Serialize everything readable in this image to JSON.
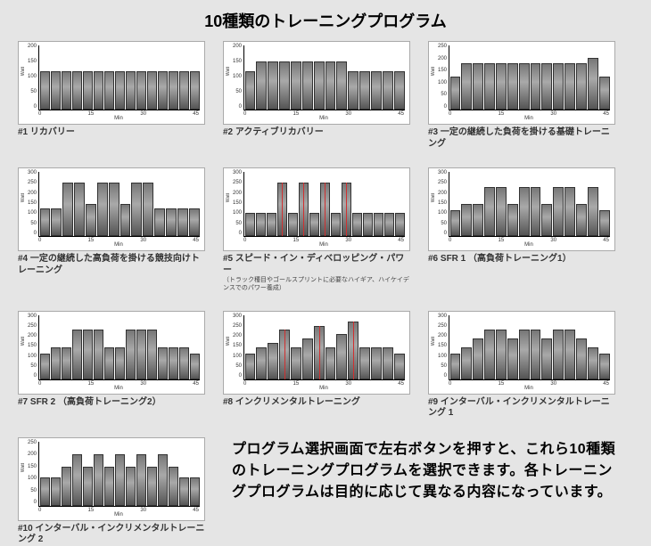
{
  "page_title": "10種類のトレーニングプログラム",
  "axis": {
    "xlabel": "Min",
    "ylabel": "Watt"
  },
  "xticks": [
    "0",
    "15",
    "30",
    "45"
  ],
  "description": "プログラム選択画面で左右ボタンを押すと、これら10種類のトレーニングプログラムを選択できます。各トレーニングプログラムは目的に応じて異なる内容になっています。",
  "chart_data": [
    {
      "id": 1,
      "label": "#1 リカバリー",
      "type": "bar",
      "ymax": 200,
      "yticks": [
        "200",
        "150",
        "100",
        "50",
        "0"
      ],
      "values": [
        120,
        120,
        120,
        120,
        120,
        120,
        120,
        120,
        120,
        120,
        120,
        120,
        120,
        120,
        120
      ],
      "markers": []
    },
    {
      "id": 2,
      "label": "#2 アクティブリカバリー",
      "type": "bar",
      "ymax": 200,
      "yticks": [
        "200",
        "150",
        "100",
        "50",
        "0"
      ],
      "values": [
        120,
        150,
        150,
        150,
        150,
        150,
        150,
        150,
        150,
        120,
        120,
        120,
        120,
        120
      ],
      "markers": []
    },
    {
      "id": 3,
      "label": "#3 一定の継続した負荷を掛ける基礎トレーニング",
      "type": "bar",
      "ymax": 250,
      "yticks": [
        "250",
        "200",
        "150",
        "100",
        "50",
        "0"
      ],
      "values": [
        130,
        180,
        180,
        180,
        180,
        180,
        180,
        180,
        180,
        180,
        180,
        180,
        200,
        130
      ],
      "markers": []
    },
    {
      "id": 4,
      "label": "#4 一定の継続した高負荷を掛ける競技向けトレーニング",
      "type": "bar",
      "ymax": 300,
      "yticks": [
        "300",
        "250",
        "200",
        "150",
        "100",
        "50",
        "0"
      ],
      "values": [
        130,
        130,
        250,
        250,
        150,
        250,
        250,
        150,
        250,
        250,
        130,
        130,
        130,
        130
      ],
      "markers": []
    },
    {
      "id": 5,
      "label": "#5 スピード・イン・ディベロッピング・パワー",
      "sublabel": "（トラック種目やゴールスプリントに必要なハイギア、ハイケイデンスでのパワー養成）",
      "type": "bar",
      "ymax": 300,
      "yticks": [
        "300",
        "250",
        "200",
        "150",
        "100",
        "50",
        "0"
      ],
      "values": [
        110,
        110,
        110,
        250,
        110,
        250,
        110,
        250,
        110,
        250,
        110,
        110,
        110,
        110,
        110
      ],
      "markers": [
        3,
        5,
        7,
        9
      ]
    },
    {
      "id": 6,
      "label": "#6 SFR 1 （高負荷トレーニング1）",
      "type": "bar",
      "ymax": 300,
      "yticks": [
        "300",
        "250",
        "200",
        "150",
        "100",
        "50",
        "0"
      ],
      "values": [
        120,
        150,
        150,
        230,
        230,
        150,
        230,
        230,
        150,
        230,
        230,
        150,
        230,
        120
      ],
      "markers": []
    },
    {
      "id": 7,
      "label": "#7 SFR 2 （高負荷トレーニング2）",
      "type": "bar",
      "ymax": 300,
      "yticks": [
        "300",
        "250",
        "200",
        "150",
        "100",
        "50",
        "0"
      ],
      "values": [
        120,
        150,
        150,
        230,
        230,
        230,
        150,
        150,
        230,
        230,
        230,
        150,
        150,
        150,
        120
      ],
      "markers": []
    },
    {
      "id": 8,
      "label": "#8 インクリメンタルトレーニング",
      "type": "bar",
      "ymax": 300,
      "yticks": [
        "300",
        "250",
        "200",
        "150",
        "100",
        "50",
        "0"
      ],
      "values": [
        120,
        150,
        170,
        230,
        150,
        190,
        250,
        150,
        210,
        270,
        150,
        150,
        150,
        120
      ],
      "markers": [
        3,
        6,
        9
      ]
    },
    {
      "id": 9,
      "label": "#9 インターバル・インクリメンタルトレーニング 1",
      "type": "bar",
      "ymax": 300,
      "yticks": [
        "300",
        "250",
        "200",
        "150",
        "100",
        "50",
        "0"
      ],
      "values": [
        120,
        150,
        190,
        230,
        230,
        190,
        230,
        230,
        190,
        230,
        230,
        190,
        150,
        120
      ],
      "markers": []
    },
    {
      "id": 10,
      "label": "#10 インターバル・インクリメンタルトレーニング 2",
      "type": "bar",
      "ymax": 250,
      "yticks": [
        "250",
        "200",
        "150",
        "100",
        "50",
        "0"
      ],
      "values": [
        110,
        110,
        150,
        200,
        150,
        200,
        150,
        200,
        150,
        200,
        150,
        200,
        150,
        110,
        110
      ],
      "markers": []
    }
  ]
}
